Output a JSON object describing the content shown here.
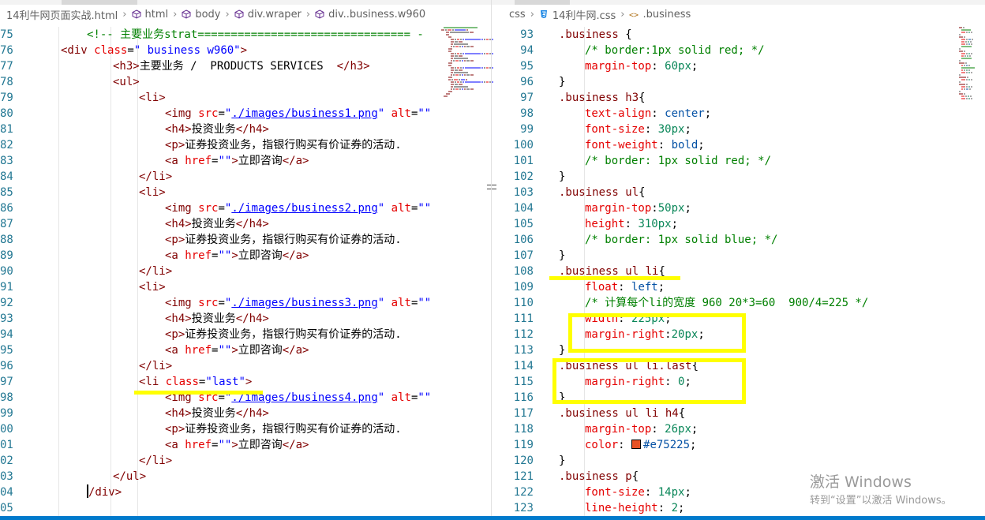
{
  "left_breadcrumb": [
    "14利牛网页面实战.html",
    "html",
    "body",
    "div.wraper",
    "div..business.w960"
  ],
  "left_breadcrumb_icons": [
    "none",
    "cube-icon",
    "cube-icon",
    "cube-icon",
    "cube-icon"
  ],
  "right_breadcrumb": [
    "css",
    "14利牛网.css",
    ".business"
  ],
  "right_breadcrumb_icons": [
    "none",
    "css3-file-icon",
    "selector-icon"
  ],
  "left_code": [
    {
      "ln": "75",
      "indent": 2,
      "tokens": [
        [
          "comment",
          "<!-- 主要业务strat================================ -"
        ]
      ]
    },
    {
      "ln": "76",
      "indent": 1,
      "tokens": [
        [
          "tag",
          "<div"
        ],
        [
          "text",
          " "
        ],
        [
          "attr",
          "class"
        ],
        [
          "text",
          "="
        ],
        [
          "str",
          "\" business w960\""
        ],
        [
          "tag",
          ">"
        ]
      ]
    },
    {
      "ln": "77",
      "indent": 3,
      "tokens": [
        [
          "tag",
          "<h3>"
        ],
        [
          "text",
          "主要业务 /  PRODUCTS SERVICES  "
        ],
        [
          "tag",
          "</h3>"
        ]
      ]
    },
    {
      "ln": "78",
      "indent": 3,
      "tokens": [
        [
          "tag",
          "<ul>"
        ]
      ]
    },
    {
      "ln": "79",
      "indent": 4,
      "tokens": [
        [
          "tag",
          "<li>"
        ]
      ]
    },
    {
      "ln": "80",
      "indent": 5,
      "tokens": [
        [
          "tag",
          "<img"
        ],
        [
          "text",
          " "
        ],
        [
          "attr",
          "src"
        ],
        [
          "text",
          "="
        ],
        [
          "str",
          "\""
        ],
        [
          "url",
          "./images/business1.png"
        ],
        [
          "str",
          "\""
        ],
        [
          "text",
          " "
        ],
        [
          "attr",
          "alt"
        ],
        [
          "text",
          "="
        ],
        [
          "str",
          "\"\""
        ]
      ]
    },
    {
      "ln": "81",
      "indent": 5,
      "tokens": [
        [
          "tag",
          "<h4>"
        ],
        [
          "text",
          "投资业务"
        ],
        [
          "tag",
          "</h4>"
        ]
      ]
    },
    {
      "ln": "82",
      "indent": 5,
      "tokens": [
        [
          "tag",
          "<p>"
        ],
        [
          "text",
          "证券投资业务，指银行购买有价证券的活动."
        ]
      ]
    },
    {
      "ln": "83",
      "indent": 5,
      "tokens": [
        [
          "tag",
          "<a"
        ],
        [
          "text",
          " "
        ],
        [
          "attr",
          "href"
        ],
        [
          "text",
          "="
        ],
        [
          "str",
          "\"\""
        ],
        [
          "tag",
          ">"
        ],
        [
          "text",
          "立即咨询"
        ],
        [
          "tag",
          "</a>"
        ]
      ]
    },
    {
      "ln": "84",
      "indent": 4,
      "tokens": [
        [
          "tag",
          "</li>"
        ]
      ]
    },
    {
      "ln": "85",
      "indent": 4,
      "tokens": [
        [
          "tag",
          "<li>"
        ]
      ]
    },
    {
      "ln": "86",
      "indent": 5,
      "tokens": [
        [
          "tag",
          "<img"
        ],
        [
          "text",
          " "
        ],
        [
          "attr",
          "src"
        ],
        [
          "text",
          "="
        ],
        [
          "str",
          "\""
        ],
        [
          "url",
          "./images/business2.png"
        ],
        [
          "str",
          "\""
        ],
        [
          "text",
          " "
        ],
        [
          "attr",
          "alt"
        ],
        [
          "text",
          "="
        ],
        [
          "str",
          "\"\""
        ]
      ]
    },
    {
      "ln": "87",
      "indent": 5,
      "tokens": [
        [
          "tag",
          "<h4>"
        ],
        [
          "text",
          "投资业务"
        ],
        [
          "tag",
          "</h4>"
        ]
      ]
    },
    {
      "ln": "88",
      "indent": 5,
      "tokens": [
        [
          "tag",
          "<p>"
        ],
        [
          "text",
          "证券投资业务，指银行购买有价证券的活动."
        ]
      ]
    },
    {
      "ln": "89",
      "indent": 5,
      "tokens": [
        [
          "tag",
          "<a"
        ],
        [
          "text",
          " "
        ],
        [
          "attr",
          "href"
        ],
        [
          "text",
          "="
        ],
        [
          "str",
          "\"\""
        ],
        [
          "tag",
          ">"
        ],
        [
          "text",
          "立即咨询"
        ],
        [
          "tag",
          "</a>"
        ]
      ]
    },
    {
      "ln": "90",
      "indent": 4,
      "tokens": [
        [
          "tag",
          "</li>"
        ]
      ]
    },
    {
      "ln": "91",
      "indent": 4,
      "tokens": [
        [
          "tag",
          "<li>"
        ]
      ]
    },
    {
      "ln": "92",
      "indent": 5,
      "tokens": [
        [
          "tag",
          "<img"
        ],
        [
          "text",
          " "
        ],
        [
          "attr",
          "src"
        ],
        [
          "text",
          "="
        ],
        [
          "str",
          "\""
        ],
        [
          "url",
          "./images/business3.png"
        ],
        [
          "str",
          "\""
        ],
        [
          "text",
          " "
        ],
        [
          "attr",
          "alt"
        ],
        [
          "text",
          "="
        ],
        [
          "str",
          "\"\""
        ]
      ]
    },
    {
      "ln": "93",
      "indent": 5,
      "tokens": [
        [
          "tag",
          "<h4>"
        ],
        [
          "text",
          "投资业务"
        ],
        [
          "tag",
          "</h4>"
        ]
      ]
    },
    {
      "ln": "94",
      "indent": 5,
      "tokens": [
        [
          "tag",
          "<p>"
        ],
        [
          "text",
          "证券投资业务，指银行购买有价证券的活动."
        ]
      ]
    },
    {
      "ln": "95",
      "indent": 5,
      "tokens": [
        [
          "tag",
          "<a"
        ],
        [
          "text",
          " "
        ],
        [
          "attr",
          "href"
        ],
        [
          "text",
          "="
        ],
        [
          "str",
          "\"\""
        ],
        [
          "tag",
          ">"
        ],
        [
          "text",
          "立即咨询"
        ],
        [
          "tag",
          "</a>"
        ]
      ]
    },
    {
      "ln": "96",
      "indent": 4,
      "tokens": [
        [
          "tag",
          "</li>"
        ]
      ]
    },
    {
      "ln": "97",
      "indent": 4,
      "tokens": [
        [
          "tag",
          "<li"
        ],
        [
          "text",
          " "
        ],
        [
          "attr",
          "class"
        ],
        [
          "text",
          "="
        ],
        [
          "str",
          "\"last\""
        ],
        [
          "tag",
          ">"
        ]
      ]
    },
    {
      "ln": "98",
      "indent": 5,
      "tokens": [
        [
          "tag",
          "<img"
        ],
        [
          "text",
          " "
        ],
        [
          "attr",
          "src"
        ],
        [
          "text",
          "="
        ],
        [
          "str",
          "\""
        ],
        [
          "url",
          "./images/business4.png"
        ],
        [
          "str",
          "\""
        ],
        [
          "text",
          " "
        ],
        [
          "attr",
          "alt"
        ],
        [
          "text",
          "="
        ],
        [
          "str",
          "\"\""
        ]
      ]
    },
    {
      "ln": "99",
      "indent": 5,
      "tokens": [
        [
          "tag",
          "<h4>"
        ],
        [
          "text",
          "投资业务"
        ],
        [
          "tag",
          "</h4>"
        ]
      ]
    },
    {
      "ln": "00",
      "indent": 5,
      "tokens": [
        [
          "tag",
          "<p>"
        ],
        [
          "text",
          "证券投资业务，指银行购买有价证券的活动."
        ]
      ]
    },
    {
      "ln": "01",
      "indent": 5,
      "tokens": [
        [
          "tag",
          "<a"
        ],
        [
          "text",
          " "
        ],
        [
          "attr",
          "href"
        ],
        [
          "text",
          "="
        ],
        [
          "str",
          "\"\""
        ],
        [
          "tag",
          ">"
        ],
        [
          "text",
          "立即咨询"
        ],
        [
          "tag",
          "</a>"
        ]
      ]
    },
    {
      "ln": "02",
      "indent": 4,
      "tokens": [
        [
          "tag",
          "</li>"
        ]
      ]
    },
    {
      "ln": "03",
      "indent": 3,
      "tokens": [
        [
          "tag",
          "</ul>"
        ]
      ]
    },
    {
      "ln": "04",
      "indent": 2,
      "tokens": [
        [
          "cursor",
          ""
        ],
        [
          "tag",
          "/div>"
        ]
      ]
    },
    {
      "ln": "05",
      "indent": 0,
      "tokens": []
    }
  ],
  "right_code": [
    {
      "ln": "93",
      "indent": 0,
      "tokens": [
        [
          "sel",
          ".business"
        ],
        [
          "punc",
          " {"
        ]
      ]
    },
    {
      "ln": "94",
      "indent": 1,
      "tokens": [
        [
          "comment",
          "/* border:1px solid red; */"
        ]
      ]
    },
    {
      "ln": "95",
      "indent": 1,
      "tokens": [
        [
          "prop",
          "margin-top"
        ],
        [
          "punc",
          ": "
        ],
        [
          "num",
          "60px"
        ],
        [
          "punc",
          ";"
        ]
      ]
    },
    {
      "ln": "96",
      "indent": 0,
      "tokens": [
        [
          "punc",
          "}"
        ]
      ]
    },
    {
      "ln": "97",
      "indent": 0,
      "tokens": [
        [
          "sel",
          ".business h3"
        ],
        [
          "punc",
          "{"
        ]
      ]
    },
    {
      "ln": "98",
      "indent": 1,
      "tokens": [
        [
          "prop",
          "text-align"
        ],
        [
          "punc",
          ": "
        ],
        [
          "val",
          "center"
        ],
        [
          "punc",
          ";"
        ]
      ]
    },
    {
      "ln": "99",
      "indent": 1,
      "tokens": [
        [
          "prop",
          "font-size"
        ],
        [
          "punc",
          ": "
        ],
        [
          "num",
          "30px"
        ],
        [
          "punc",
          ";"
        ]
      ]
    },
    {
      "ln": "100",
      "indent": 1,
      "tokens": [
        [
          "prop",
          "font-weight"
        ],
        [
          "punc",
          ": "
        ],
        [
          "val",
          "bold"
        ],
        [
          "punc",
          ";"
        ]
      ]
    },
    {
      "ln": "101",
      "indent": 1,
      "tokens": [
        [
          "comment",
          "/* border: 1px solid red; */"
        ]
      ]
    },
    {
      "ln": "102",
      "indent": 0,
      "tokens": [
        [
          "punc",
          "}"
        ]
      ]
    },
    {
      "ln": "103",
      "indent": 0,
      "tokens": [
        [
          "sel",
          ".business ul"
        ],
        [
          "punc",
          "{"
        ]
      ]
    },
    {
      "ln": "104",
      "indent": 1,
      "tokens": [
        [
          "prop",
          "margin-top"
        ],
        [
          "punc",
          ":"
        ],
        [
          "num",
          "50px"
        ],
        [
          "punc",
          ";"
        ]
      ]
    },
    {
      "ln": "105",
      "indent": 1,
      "tokens": [
        [
          "prop",
          "height"
        ],
        [
          "punc",
          ": "
        ],
        [
          "num",
          "310px"
        ],
        [
          "punc",
          ";"
        ]
      ]
    },
    {
      "ln": "106",
      "indent": 1,
      "tokens": [
        [
          "comment",
          "/* border: 1px solid blue; */"
        ]
      ]
    },
    {
      "ln": "107",
      "indent": 0,
      "tokens": [
        [
          "punc",
          "}"
        ]
      ]
    },
    {
      "ln": "108",
      "indent": 0,
      "tokens": [
        [
          "sel",
          ".business ul li"
        ],
        [
          "punc",
          "{"
        ]
      ]
    },
    {
      "ln": "109",
      "indent": 1,
      "tokens": [
        [
          "prop",
          "float"
        ],
        [
          "punc",
          ": "
        ],
        [
          "val",
          "left"
        ],
        [
          "punc",
          ";"
        ]
      ]
    },
    {
      "ln": "110",
      "indent": 1,
      "tokens": [
        [
          "comment",
          "/* 计算每个li的宽度 960 20*3=60  900/4=225 */"
        ]
      ]
    },
    {
      "ln": "111",
      "indent": 1,
      "tokens": [
        [
          "prop",
          "width"
        ],
        [
          "punc",
          ": "
        ],
        [
          "num",
          "225px"
        ],
        [
          "punc",
          ";"
        ]
      ]
    },
    {
      "ln": "112",
      "indent": 1,
      "tokens": [
        [
          "prop",
          "margin-right"
        ],
        [
          "punc",
          ":"
        ],
        [
          "num",
          "20px"
        ],
        [
          "punc",
          ";"
        ]
      ]
    },
    {
      "ln": "113",
      "indent": 0,
      "tokens": [
        [
          "punc",
          "}"
        ]
      ]
    },
    {
      "ln": "114",
      "indent": 0,
      "tokens": [
        [
          "sel",
          ".business ul li.last"
        ],
        [
          "punc",
          "{"
        ]
      ]
    },
    {
      "ln": "115",
      "indent": 1,
      "tokens": [
        [
          "prop",
          "margin-right"
        ],
        [
          "punc",
          ": "
        ],
        [
          "num",
          "0"
        ],
        [
          "punc",
          ";"
        ]
      ]
    },
    {
      "ln": "116",
      "indent": 0,
      "tokens": [
        [
          "punc",
          "}"
        ]
      ]
    },
    {
      "ln": "117",
      "indent": 0,
      "tokens": [
        [
          "sel",
          ".business ul li h4"
        ],
        [
          "punc",
          "{"
        ]
      ]
    },
    {
      "ln": "118",
      "indent": 1,
      "tokens": [
        [
          "prop",
          "margin-top"
        ],
        [
          "punc",
          ": "
        ],
        [
          "num",
          "26px"
        ],
        [
          "punc",
          ";"
        ]
      ]
    },
    {
      "ln": "119",
      "indent": 1,
      "tokens": [
        [
          "prop",
          "color"
        ],
        [
          "punc",
          ": "
        ],
        [
          "swatch",
          ""
        ],
        [
          "val",
          "#e75225"
        ],
        [
          "punc",
          ";"
        ]
      ]
    },
    {
      "ln": "120",
      "indent": 0,
      "tokens": [
        [
          "punc",
          "}"
        ]
      ]
    },
    {
      "ln": "121",
      "indent": 0,
      "tokens": [
        [
          "sel",
          ".business p"
        ],
        [
          "punc",
          "{"
        ]
      ]
    },
    {
      "ln": "122",
      "indent": 1,
      "tokens": [
        [
          "prop",
          "font-size"
        ],
        [
          "punc",
          ": "
        ],
        [
          "num",
          "14px"
        ],
        [
          "punc",
          ";"
        ]
      ]
    },
    {
      "ln": "123",
      "indent": 1,
      "tokens": [
        [
          "prop",
          "line-height"
        ],
        [
          "punc",
          ": "
        ],
        [
          "num",
          "2"
        ],
        [
          "punc",
          ";"
        ]
      ]
    }
  ],
  "watermark": {
    "title": "激活 Windows",
    "subtitle": "转到“设置”以激活 Windows。"
  },
  "colors": {
    "highlight": "#ffff00",
    "swatch": "#e75225",
    "statusbar": "#007acc"
  }
}
